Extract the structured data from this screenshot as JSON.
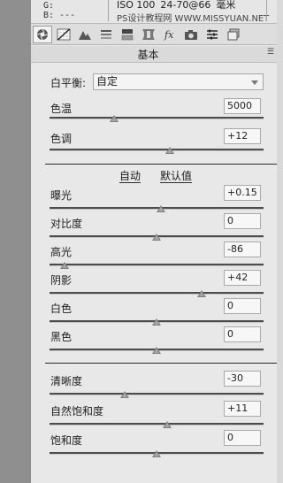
{
  "info": {
    "rgb_lines": [
      "G:",
      "B: ---"
    ],
    "exif": [
      "ISO 100",
      "24-70@66",
      "毫米"
    ],
    "watermark": "PS设计教程网 WWW.MISSYUAN.NET"
  },
  "tabs": [
    {
      "icon": "aperture-icon",
      "label": "基本"
    },
    {
      "icon": "tone-curve-icon"
    },
    {
      "icon": "detail-icon"
    },
    {
      "icon": "hsl-icon"
    },
    {
      "icon": "split-toning-icon"
    },
    {
      "icon": "lens-corrections-icon"
    },
    {
      "icon": "fx-icon",
      "text": "fx"
    },
    {
      "icon": "camera-calibration-icon"
    },
    {
      "icon": "presets-icon"
    },
    {
      "icon": "snapshots-icon"
    }
  ],
  "section": {
    "title": "基本",
    "menu_glyph": "☰"
  },
  "white_balance": {
    "label": "白平衡:",
    "value": "自定"
  },
  "temperature": {
    "label": "色温",
    "value": "5000",
    "level": 0.3
  },
  "tint": {
    "label": "色调",
    "value": "+12",
    "level": 0.56
  },
  "auto_label": "自动",
  "default_label": "默认值",
  "tone": [
    {
      "key": "exposure",
      "label": "曝光",
      "value": "+0.15",
      "level": 0.52
    },
    {
      "key": "contrast",
      "label": "对比度",
      "value": "0",
      "level": 0.5
    },
    {
      "key": "highlights",
      "label": "高光",
      "value": "-86",
      "level": 0.07
    },
    {
      "key": "shadows",
      "label": "阴影",
      "value": "+42",
      "level": 0.71
    },
    {
      "key": "whites",
      "label": "白色",
      "value": "0",
      "level": 0.5
    },
    {
      "key": "blacks",
      "label": "黑色",
      "value": "0",
      "level": 0.5
    }
  ],
  "presence": [
    {
      "key": "clarity",
      "label": "清晰度",
      "value": "-30",
      "level": 0.35
    },
    {
      "key": "vibrance",
      "label": "自然饱和度",
      "value": "+11",
      "level": 0.55
    },
    {
      "key": "saturation",
      "label": "饱和度",
      "value": "0",
      "level": 0.5
    }
  ]
}
